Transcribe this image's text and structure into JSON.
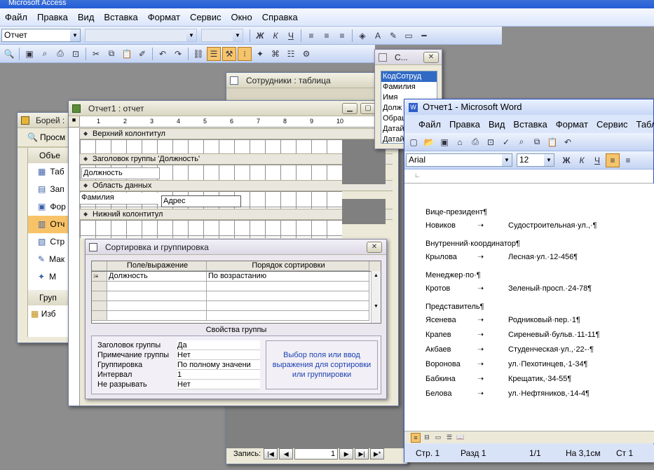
{
  "app": {
    "title": "Microsoft Access",
    "menu": [
      "Файл",
      "Правка",
      "Вид",
      "Вставка",
      "Формат",
      "Сервис",
      "Окно",
      "Справка"
    ],
    "object_combo": "Отчет"
  },
  "db_window": {
    "title": "Борей :",
    "preview": "Просм",
    "objects_label": "Объе",
    "items": [
      "Таб",
      "Зап",
      "Фор",
      "Отч",
      "Стр",
      "Мак",
      "М"
    ],
    "groups_label": "Груп",
    "favorites": "Изб"
  },
  "table_window": {
    "title": "Сотрудники : таблица"
  },
  "field_list": {
    "title": "С...",
    "items": [
      "КодСотруд",
      "Фамилия",
      "Имя",
      "Долж",
      "Обращ",
      "Датай",
      "Датай"
    ]
  },
  "report_window": {
    "title": "Отчет1 : отчет",
    "ruler": [
      "1",
      "2",
      "3",
      "4",
      "5",
      "6",
      "7",
      "8",
      "9",
      "10"
    ],
    "sections": {
      "page_header": "Верхний колонтитул",
      "group_header": "Заголовок группы 'Должность'",
      "detail": "Область данных",
      "page_footer": "Нижний колонтитул"
    },
    "controls": {
      "dolzhnost": "Должность",
      "familiya": "Фамилия",
      "adres": "Адрес"
    },
    "record_label": "Запись:",
    "record_num": "1"
  },
  "sorting_dialog": {
    "title": "Сортировка и группировка",
    "col_field": "Поле/выражение",
    "col_order": "Порядок сортировки",
    "row1_field": "Должность",
    "row1_order": "По возрастанию",
    "group_props_title": "Свойства группы",
    "props": [
      {
        "name": "Заголовок группы",
        "value": "Да"
      },
      {
        "name": "Примечание группы",
        "value": "Нет"
      },
      {
        "name": "Группировка",
        "value": "По полному значени"
      },
      {
        "name": "Интервал",
        "value": "1"
      },
      {
        "name": "Не разрывать",
        "value": "Нет"
      }
    ],
    "hint": "Выбор поля или ввод выражения для сортировки или группировки"
  },
  "word_window": {
    "title": "Отчет1 - Microsoft Word",
    "menu": [
      "Файл",
      "Правка",
      "Вид",
      "Вставка",
      "Формат",
      "Сервис",
      "Табл"
    ],
    "font": "Arial",
    "size": "12",
    "lines": [
      {
        "type": "head",
        "text": "Вице-президент¶"
      },
      {
        "type": "row",
        "name": "Новиков",
        "addr": "Судостроительная·ул.,·¶"
      },
      {
        "type": "head",
        "text": "Внутренний·координатор¶"
      },
      {
        "type": "row",
        "name": "Крылова",
        "addr": "Лесная·ул.·12-456¶"
      },
      {
        "type": "head",
        "text": "Менеджер·по·¶"
      },
      {
        "type": "row",
        "name": "Кротов",
        "addr": "Зеленый·просп.·24-78¶"
      },
      {
        "type": "head",
        "text": "Представитель¶"
      },
      {
        "type": "row",
        "name": "Ясенева",
        "addr": "Родниковый·пер.·1¶"
      },
      {
        "type": "row",
        "name": "Крапев",
        "addr": "Сиреневый·бульв.·11-11¶"
      },
      {
        "type": "row",
        "name": "Акбаев",
        "addr": "Студенческая·ул.,·22-·¶"
      },
      {
        "type": "row",
        "name": "Воронова",
        "addr": "ул.·Пехотинцев,·1-34¶"
      },
      {
        "type": "row",
        "name": "Бабкина",
        "addr": "Крещатик,·34-55¶"
      },
      {
        "type": "row",
        "name": "Белова",
        "addr": "ул.·Нефтяников,·14-4¶"
      }
    ],
    "status": {
      "page": "Стр. 1",
      "section": "Разд 1",
      "pages": "1/1",
      "at": "На 3,1см",
      "col": "Ст 1"
    }
  },
  "colors": {
    "accent": "#f6c46a",
    "title_blue": "#245ed6"
  }
}
